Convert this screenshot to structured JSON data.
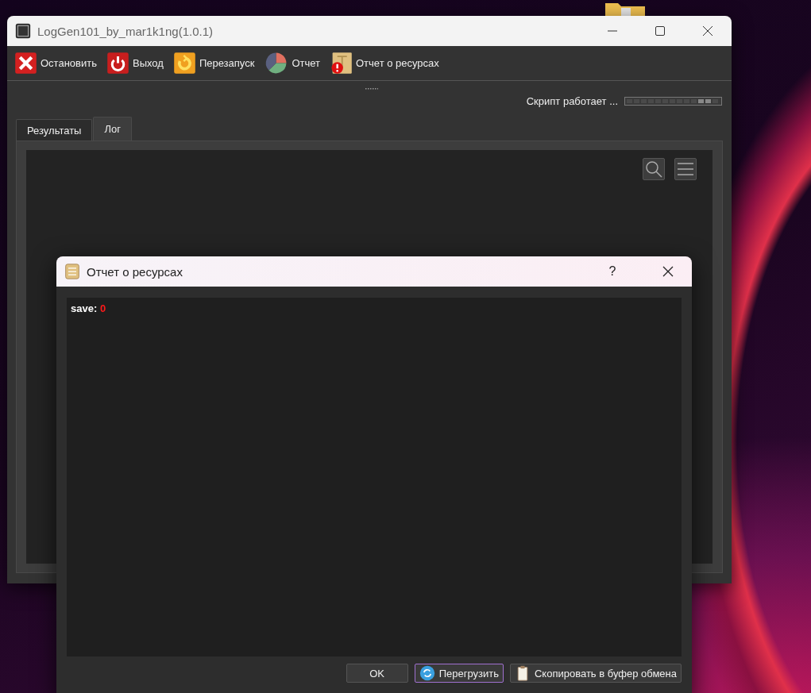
{
  "main_window": {
    "title": "LogGen101_by_mar1k1ng(1.0.1)",
    "toolbar": [
      {
        "label": "Остановить",
        "kind": "stop"
      },
      {
        "label": "Выход",
        "kind": "exit"
      },
      {
        "label": "Перезапуск",
        "kind": "restart"
      },
      {
        "label": "Отчет",
        "kind": "report"
      },
      {
        "label": "Отчет о ресурсах",
        "kind": "resources"
      }
    ],
    "status": "Скрипт работает ...",
    "tabs": [
      {
        "label": "Результаты",
        "selected": false
      },
      {
        "label": "Лог",
        "selected": true
      }
    ]
  },
  "dialog": {
    "title": "Отчет о ресурсах",
    "help": "?",
    "report": [
      {
        "key": "save:",
        "value": "0"
      }
    ],
    "buttons": [
      {
        "label": "OK",
        "kind": "plain",
        "focused": false
      },
      {
        "label": "Перегрузить",
        "kind": "reload",
        "focused": true
      },
      {
        "label": "Скопировать в буфер обмена",
        "kind": "copy",
        "focused": false
      }
    ]
  }
}
